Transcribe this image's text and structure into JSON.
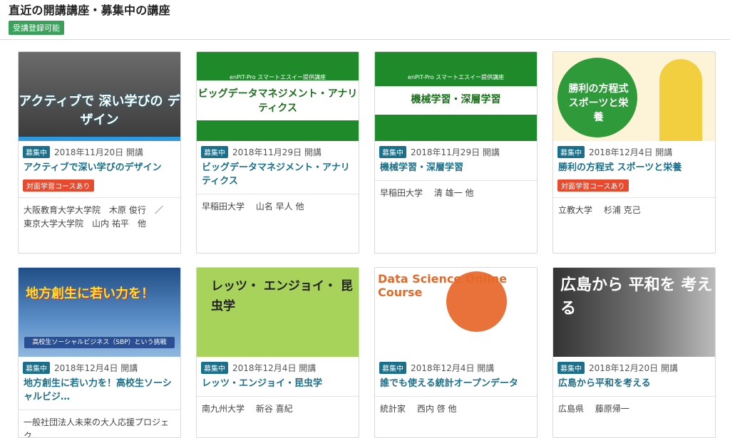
{
  "header": {
    "title": "直近の開講講座・募集中の講座",
    "badge": "受講登録可能"
  },
  "courses": [
    {
      "status": "募集中",
      "date": "2018年11月20日 開講",
      "title": "アクティブで深い学びのデザイン",
      "badge": "対面学習コースあり",
      "org": "大阪教育大学大学院　木原 俊行　／　東京大学大学院　山内 祐平　他",
      "thumb_text": "アクティブで 深い学びの デザイン"
    },
    {
      "status": "募集中",
      "date": "2018年11月29日 開講",
      "title": "ビッグデータマネジメント・アナリティクス",
      "badge": "",
      "org": "早稲田大学　 山名 早人 他",
      "thumb_sub": "enPiT-Pro スマートエスイー提供講座",
      "thumb_text": "ビッグデータマネジメント・アナリティクス"
    },
    {
      "status": "募集中",
      "date": "2018年11月29日 開講",
      "title": "機械学習・深層学習",
      "badge": "",
      "org": "早稲田大学　 清 雄一 他",
      "thumb_sub": "enPiT-Pro スマートエスイー提供講座",
      "thumb_text": "機械学習・深層学習"
    },
    {
      "status": "募集中",
      "date": "2018年12月4日 開講",
      "title": "勝利の方程式 スポーツと栄養",
      "badge": "対面学習コースあり",
      "org": "立教大学　 杉浦 克己",
      "thumb_text": "勝利の方程式 スポーツと栄養"
    },
    {
      "status": "募集中",
      "date": "2018年12月4日 開講",
      "title": "地方創生に若い力を！高校生ソーシャルビジ…",
      "badge": "",
      "org": "一般社団法人未来の大人応援プロジェク",
      "thumb_text": "地方創生に若い力を！",
      "thumb_sub": "高校生ソーシャルビジネス（SBP）という挑戦"
    },
    {
      "status": "募集中",
      "date": "2018年12月4日 開講",
      "title": "レッツ・エンジョイ・昆虫学",
      "badge": "",
      "org": "南九州大学　 新谷 喜紀",
      "thumb_text": "レッツ・ エンジョイ・ 昆虫学"
    },
    {
      "status": "募集中",
      "date": "2018年12月4日 開講",
      "title": "誰でも使える統計オープンデータ",
      "badge": "",
      "org": "統計家　 西内 啓 他",
      "thumb_text": "Data Science Online Course"
    },
    {
      "status": "募集中",
      "date": "2018年12月20日 開講",
      "title": "広島から平和を考える",
      "badge": "",
      "org": "広島県　 藤原帰一",
      "thumb_text": "広島から 平和を 考える"
    }
  ]
}
